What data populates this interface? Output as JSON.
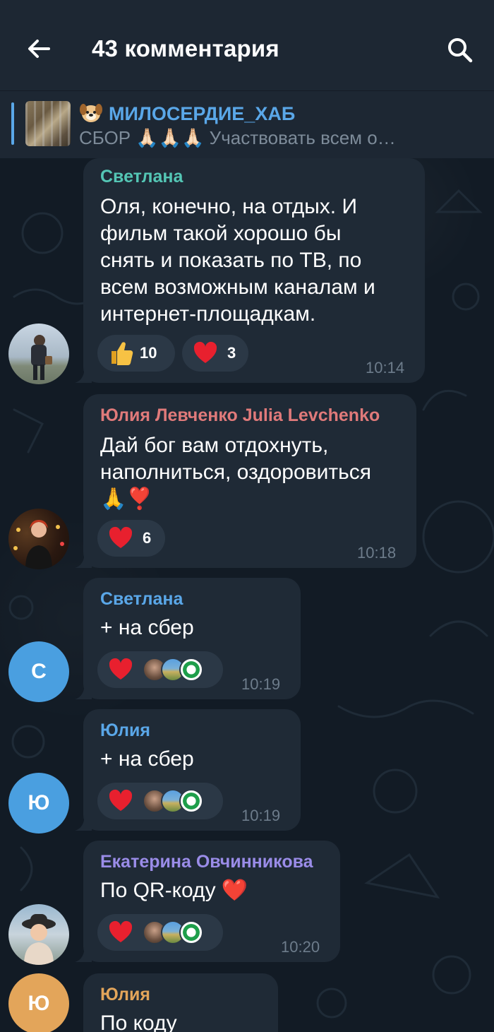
{
  "header": {
    "title": "43 комментария"
  },
  "pinned": {
    "channel_name": "МИЛОСЕРДИЕ_ХАБ",
    "preview_text": "СБОР 🙏🏻🙏🏻🙏🏻 Участвовать всем о…"
  },
  "messages": [
    {
      "sender": "Светлана",
      "sender_color": "#54c6b5",
      "lines": [
        "Оля, конечно, на отдых. И",
        "фильм такой хорошо бы",
        "снять и показать по ТВ, по",
        "всем возможным каналам и",
        "интернет-площадкам."
      ],
      "reactions": [
        {
          "emoji": "👍",
          "count": "10"
        },
        {
          "emoji": "❤️",
          "count": "3"
        }
      ],
      "time": "10:14"
    },
    {
      "sender": "Юлия Левченко Julia Levchenko",
      "sender_color": "#e07a7a",
      "lines": [
        "Дай бог вам отдохнуть,",
        "наполниться, оздоровиться",
        "🙏❣️"
      ],
      "reactions": [
        {
          "emoji": "❤️",
          "count": "6"
        }
      ],
      "time": "10:18"
    },
    {
      "sender": "Светлана",
      "sender_color": "#5aa7e8",
      "avatar_letter": "С",
      "lines": [
        "+ на сбер"
      ],
      "time": "10:19"
    },
    {
      "sender": "Юлия",
      "sender_color": "#5aa7e8",
      "avatar_letter": "Ю",
      "lines": [
        "+ на сбер"
      ],
      "time": "10:19"
    },
    {
      "sender": "Екатерина Овчинникова",
      "sender_color": "#9a8ce8",
      "lines": [
        "По QR-коду ❤️"
      ],
      "time": "10:20"
    },
    {
      "sender": "Юлия",
      "sender_color": "#e3a55a",
      "avatar_letter": "Ю",
      "lines": [
        "По коду"
      ]
    }
  ],
  "colors": {
    "header_bg": "#1d2733",
    "bubble_bg": "#1f2a36",
    "accent": "#5aa7e8",
    "heart": "#e8202e"
  }
}
